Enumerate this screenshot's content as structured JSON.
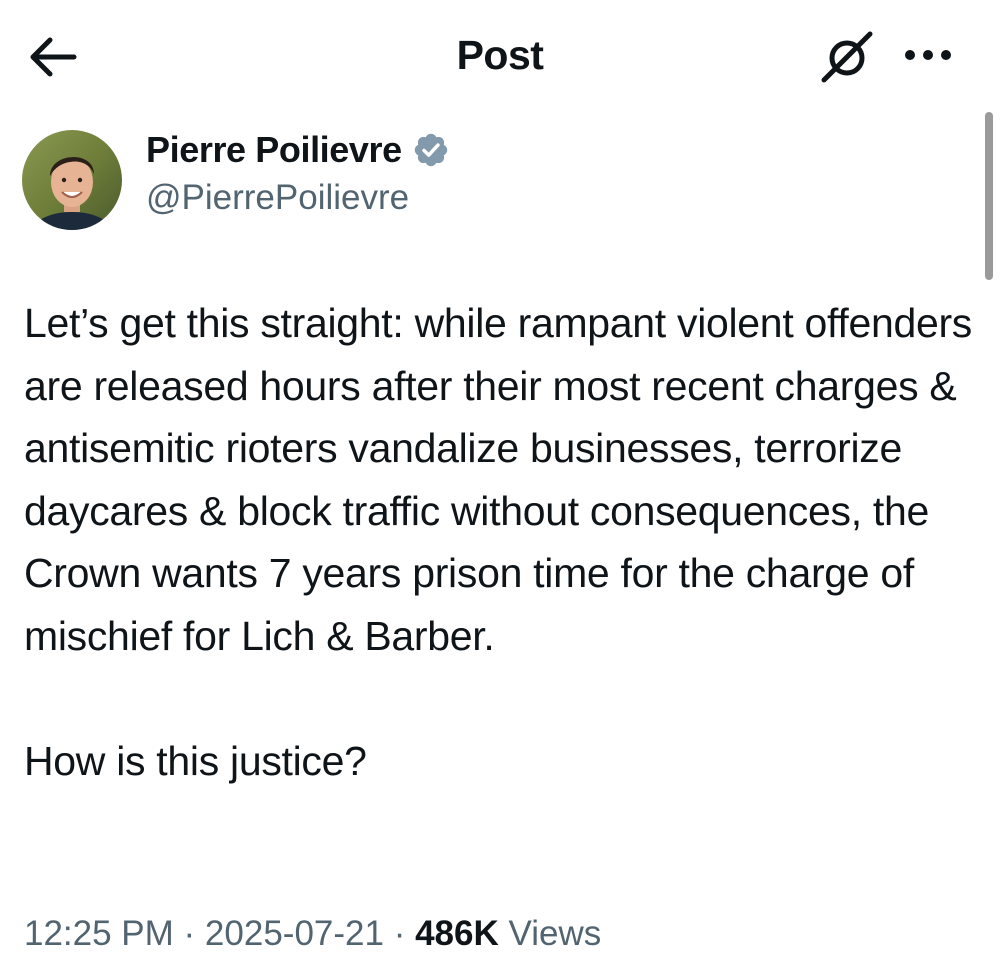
{
  "header": {
    "title": "Post",
    "back_icon": "arrow-left-icon",
    "grok_icon": "grok-icon",
    "more_icon": "more-dots-icon"
  },
  "author": {
    "display_name": "Pierre Poilievre",
    "handle": "@PierrePoilievre",
    "verified": true,
    "verified_icon": "verified-badge-icon",
    "avatar": "profile-photo"
  },
  "post": {
    "paragraph_1": "Let’s get this straight: while rampant violent offenders are released hours after their most recent charges & antisemitic rioters vandalize businesses, terrorize daycares & block traffic without consequences, the Crown wants 7 years prison time for the charge of mischief for Lich & Barber.",
    "paragraph_2": "How is this justice?"
  },
  "meta": {
    "time": "12:25 PM",
    "separator": " · ",
    "date": "2025-07-21",
    "views_count": "486K",
    "views_label": "Views"
  },
  "colors": {
    "text_primary": "#0f1419",
    "text_secondary": "#536471",
    "verified_badge": "#829aab",
    "background": "#ffffff"
  }
}
